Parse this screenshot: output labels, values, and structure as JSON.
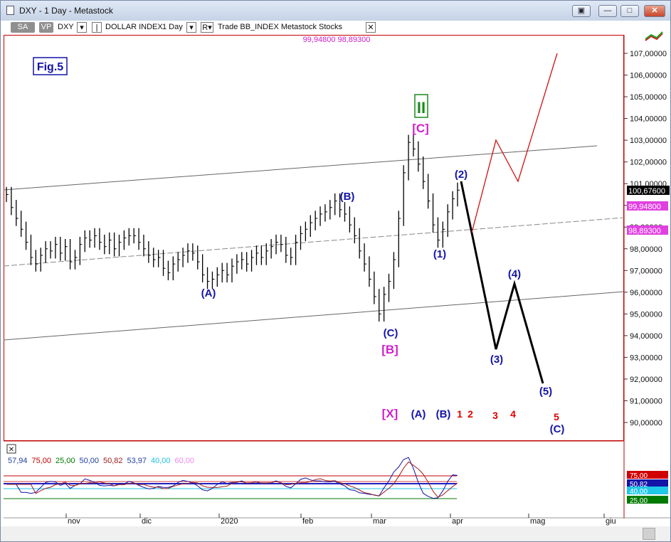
{
  "window": {
    "title": "DXY - 1 Day - Metastock",
    "buttons": [
      "▣",
      "—",
      "□",
      "✕"
    ]
  },
  "toolbar": {
    "sa_label": "SA",
    "vp_label": "VP",
    "symbol": "DXY",
    "instrument": "DOLLAR INDEX",
    "period": "1 Day",
    "rest": "Trade  BB_INDEX  Metastock  Stocks",
    "close_label": "✕",
    "bb_values": "99,94800  98,89300"
  },
  "figure_label": "Fig.5",
  "price_axis": {
    "labels": [
      "107,00000",
      "106,00000",
      "105,00000",
      "104,00000",
      "103,00000",
      "102,00000",
      "101,00000",
      "100,00000",
      "99,00000",
      "98,00000",
      "97,00000",
      "96,00000",
      "95,00000",
      "94,00000",
      "93,00000",
      "92,00000",
      "91,00000",
      "90,00000"
    ],
    "last_price": "100,67600",
    "bb_upper": "99,94800",
    "bb_lower": "98,89300"
  },
  "date_axis": [
    "nov",
    "dic",
    "2020",
    "feb",
    "mar",
    "apr",
    "mag",
    "giu"
  ],
  "wave_labels": {
    "A_low": "(A)",
    "B_high": "(B)",
    "C_low": "(C)",
    "B_bracket": "[B]",
    "C_bracket": "[C]",
    "II": "II",
    "w1": "(1)",
    "w2": "(2)",
    "w3": "(3)",
    "w4": "(4)",
    "w5": "(5)",
    "C_end": "(C)",
    "bottom_X": "[X]",
    "bottom_A": "(A)",
    "bottom_B": "(B)",
    "red_1": "1",
    "red_2": "2",
    "red_3": "3",
    "red_4": "4",
    "red_5": "5"
  },
  "indicator": {
    "close_label": "✕",
    "values": [
      {
        "text": "57,94",
        "color": "#1f3fa0"
      },
      {
        "text": "75,00",
        "color": "#c00000"
      },
      {
        "text": "25,00",
        "color": "#007a00"
      },
      {
        "text": "50,00",
        "color": "#1f3fa0"
      },
      {
        "text": "50,82",
        "color": "#a02020"
      },
      {
        "text": "53,97",
        "color": "#1f3fa0"
      },
      {
        "text": "40,00",
        "color": "#20c0e0"
      },
      {
        "text": "60,00",
        "color": "#ee88ee"
      }
    ],
    "axis_badges": {
      "upper": "75,00",
      "mid": "50,82",
      "low": "40,00",
      "bottom": "25,00"
    }
  },
  "colors": {
    "wave_blue": "#1414a8",
    "bracket_magenta": "#d020c8",
    "green": "#1a8a1a",
    "red": "#e00000",
    "projection_black": "#000000",
    "projection_red": "#d01010"
  },
  "price_series": [
    100.5,
    99.9,
    99.4,
    98.9,
    98.3,
    97.6,
    97.3,
    97.7,
    98.0,
    97.9,
    98.2,
    97.8,
    98.1,
    97.4,
    97.6,
    98.2,
    98.5,
    98.4,
    98.6,
    98.3,
    98.1,
    98.4,
    98.0,
    98.3,
    98.5,
    98.6,
    98.6,
    98.3,
    98.0,
    97.7,
    97.5,
    97.6,
    97.1,
    96.9,
    97.3,
    97.5,
    97.7,
    97.9,
    97.8,
    97.4,
    96.8,
    96.5,
    96.6,
    96.8,
    97.0,
    96.8,
    97.2,
    97.4,
    97.5,
    97.3,
    97.6,
    97.8,
    97.6,
    97.9,
    98.1,
    98.3,
    98.2,
    97.7,
    97.6,
    98.3,
    98.7,
    98.9,
    99.2,
    99.4,
    99.6,
    99.7,
    99.9,
    100.2,
    99.8,
    99.6,
    99.1,
    98.6,
    97.9,
    97.3,
    96.6,
    95.8,
    95.0,
    95.9,
    96.5,
    97.5,
    99.4,
    101.5,
    102.9,
    102.6,
    101.9,
    101.1,
    100.2,
    99.1,
    98.4,
    98.9,
    99.7,
    100.3,
    100.7
  ]
}
